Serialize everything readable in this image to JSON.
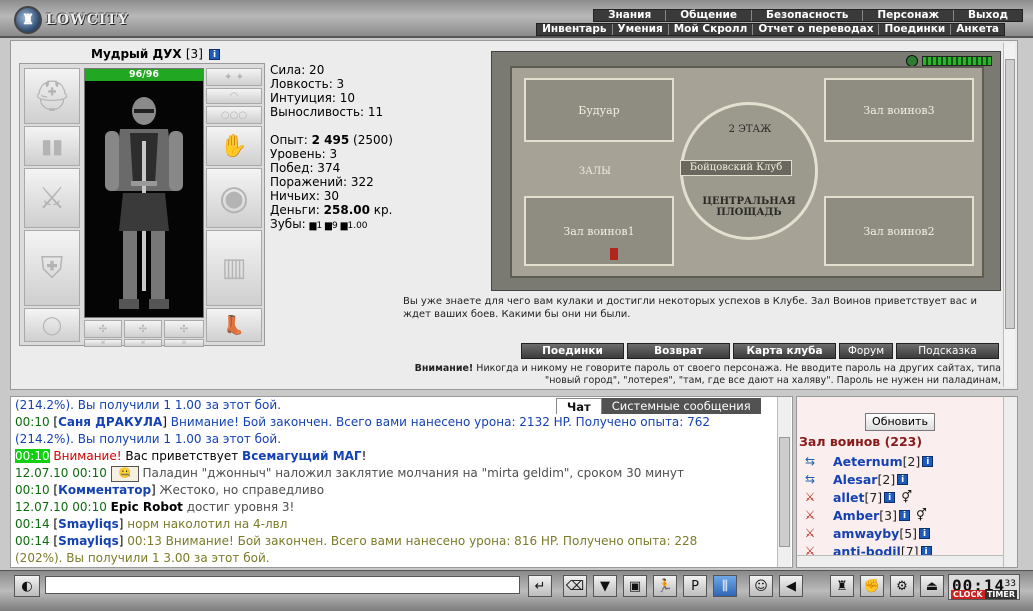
{
  "logo": {
    "text": "LOWCITY"
  },
  "top_menu": [
    "Знания",
    "Общение",
    "Безопасность",
    "Персонаж",
    "Выход"
  ],
  "sub_menu": [
    "Инвентарь",
    "Умения",
    "Мой Скролл",
    "Отчет о переводах",
    "Поединки",
    "Анкета"
  ],
  "character": {
    "name": "Мудрый ДУХ",
    "level": "[3]",
    "hp": "96/96",
    "stats": {
      "strength": "Сила: 20",
      "agility": "Ловкость: 3",
      "intuition": "Интуиция: 10",
      "endurance": "Выносливость: 11",
      "exp_label": "Опыт:",
      "exp_value": "2 495",
      "exp_next": "(2500)",
      "level_line": "Уровень: 3",
      "wins": "Побед: 374",
      "losses": "Поражений: 322",
      "draws": "Ничьих: 30",
      "money_label": "Деньги:",
      "money_value": "258.00",
      "money_unit": "кр.",
      "teeth_label": "Зубы:",
      "teeth_value": "▆1 ▆9 ▆1.00"
    }
  },
  "map": {
    "rooms": {
      "boudoir": "Будуар",
      "warriors3": "Зал воинов3",
      "warriors1": "Зал воинов1",
      "warriors2": "Зал воинов2"
    },
    "floor2": "2 ЭТАЖ",
    "club": "Бойцовский Клуб",
    "halls": "ЗАЛЫ",
    "central": "ЦЕНТРАЛЬНАЯ ПЛОЩАДЬ"
  },
  "description": "Вы уже знаете для чего вам кулаки и достигли некоторых успехов в Клубе. Зал Воинов приветствует вас и ждет ваших боев. Какими бы они ни были.",
  "buttons": {
    "battles": "Поединки",
    "return": "Возврат",
    "club_map": "Карта клуба",
    "forum": "Форум",
    "hint": "Подсказка"
  },
  "warning": {
    "label": "Внимание!",
    "text": "Никогда и никому не говорите пароль от своего персонажа. Не вводите пароль на других сайтах, типа \"новый город\", \"лотерея\", \"там, где все дают на халяву\". Пароль не нужен ни паладинам,"
  },
  "chat_tabs": [
    "Чат",
    "Системные сообщения"
  ],
  "chat": [
    {
      "time": "",
      "nick": "",
      "text": "(214.2%). Вы получили 1 1.00 за этот бой.",
      "style": "tblue"
    },
    {
      "time": "00:10",
      "nick": "Саня ДРАКУЛА",
      "text": "Внимание! Бой закончен. Всего вами нанесено урона: 2132 HP. Получено опыта: 762",
      "style": "tblue"
    },
    {
      "time": "",
      "nick": "",
      "text": "(214.2%). Вы получили 1 1.00 за этот бой.",
      "style": "tblue"
    },
    {
      "time": "00:10",
      "nick": "",
      "pre": "Внимание!",
      "text": "Вас приветствует",
      "bold": "Всемагущий МАГ",
      "post": "!",
      "style": "special"
    },
    {
      "time": "12.07.10 00:10",
      "nick": "",
      "text": "Паладин \"джонныч\" наложил заклятие молчания на \"mirta geldim\", сроком 30 минут",
      "style": "tgray",
      "icon": true
    },
    {
      "time": "00:10",
      "nick": "Комментатор",
      "text": "Жестоко, но справедливо",
      "style": "tgray"
    },
    {
      "time": "12.07.10 00:10",
      "nick": "",
      "bold": "Epic Robot",
      "text": "достиг уровня 3!",
      "style": "tgray"
    },
    {
      "time": "00:14",
      "nick": "Smayliqs",
      "text": "норм наколотил на 4-лвл",
      "style": "tolive"
    },
    {
      "time": "00:14",
      "nick": "Smayliqs",
      "text": "00:13 Внимание! Бой закончен. Всего вами нанесено урона: 816 HP. Получено опыта: 228",
      "style": "tolive"
    },
    {
      "time": "",
      "nick": "",
      "text": "(202%). Вы получили 1 3.00 за этот бой.",
      "style": "tolive"
    }
  ],
  "players_panel": {
    "refresh": "Обновить",
    "room_title": "Зал воинов (223)",
    "players": [
      {
        "name": "Aeternum",
        "level": "[2]",
        "icon": "blue",
        "extra": ""
      },
      {
        "name": "Alesar",
        "level": "[2]",
        "icon": "blue",
        "extra": ""
      },
      {
        "name": "allet",
        "level": "[7]",
        "icon": "red",
        "extra": "⚥"
      },
      {
        "name": "Amber",
        "level": "[3]",
        "icon": "red",
        "extra": "⚥"
      },
      {
        "name": "amwayby",
        "level": "[5]",
        "icon": "red",
        "extra": ""
      },
      {
        "name": "anti-bodil",
        "level": "[7]",
        "icon": "red",
        "extra": ""
      }
    ]
  },
  "clock": {
    "time": "00:14",
    "seconds": "33",
    "clock_label": "CLOCK",
    "timer_label": "TIMER"
  }
}
